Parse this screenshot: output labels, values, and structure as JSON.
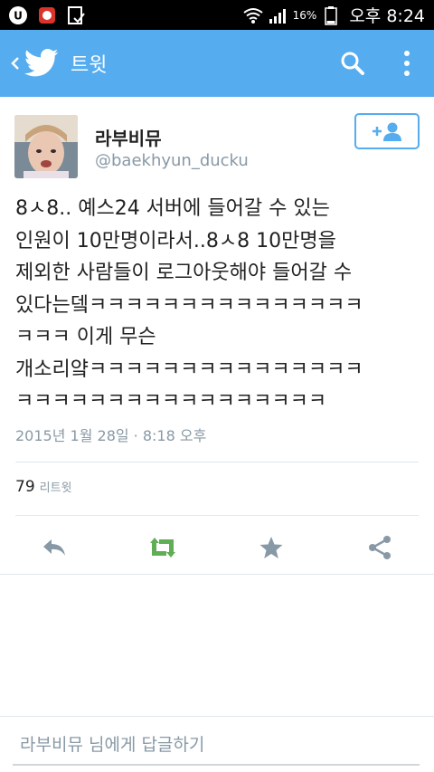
{
  "status_bar": {
    "battery_percent": "16%",
    "time": "오후 8:24"
  },
  "header": {
    "title": "트윗"
  },
  "tweet": {
    "author_name": "라부비뮤",
    "author_handle": "@baekhyun_ducku",
    "text": "8ㅅ8.. 예스24 서버에 들어갈 수 있는\n인원이 10만명이라서..8ㅅ8 10만명을\n제외한 사람들이 로그아웃해야 들어갈 수\n있다는뎈ㅋㅋㅋㅋㅋㅋㅋㅋㅋㅋㅋㅋㅋㅋㅋ\nㅋㅋㅋ 이게 무슨\n개소리얔ㅋㅋㅋㅋㅋㅋㅋㅋㅋㅋㅋㅋㅋㅋㅋ\nㅋㅋㅋㅋㅋㅋㅋㅋㅋㅋㅋㅋㅋㅋㅋㅋㅋ",
    "timestamp": "2015년 1월 28일 · 8:18 오후",
    "retweet_count": "79",
    "retweet_label": "리트윗"
  },
  "reply": {
    "placeholder": "라부비뮤 님에게 답글하기"
  },
  "colors": {
    "brand": "#55acee",
    "retweet_green": "#5fae55",
    "icon_gray": "#8899a6"
  }
}
